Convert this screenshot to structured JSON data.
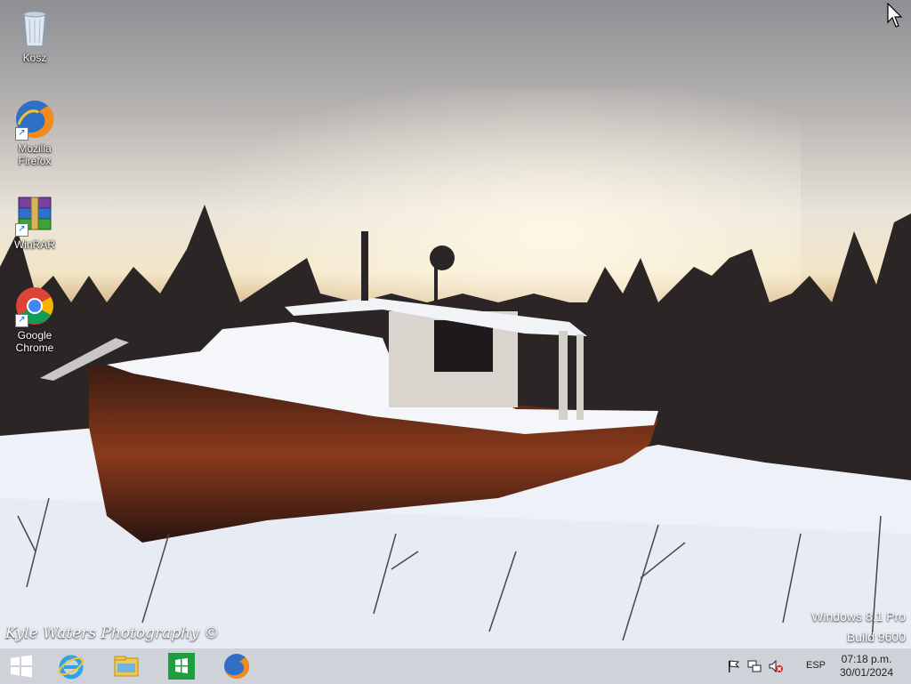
{
  "desktop": {
    "icons": [
      {
        "label": "Kosz",
        "icon": "recycle-bin-icon"
      },
      {
        "label": "Mozilla Firefox",
        "icon": "firefox-icon"
      },
      {
        "label": "WinRAR",
        "icon": "winrar-icon"
      },
      {
        "label": "Google Chrome",
        "icon": "chrome-icon"
      }
    ],
    "watermark": {
      "line1": "Windows 8.1 Pro",
      "line2": "Build 9600"
    },
    "wallpaper_credit": "Kyle Waters Photography ©"
  },
  "taskbar": {
    "pinned": [
      {
        "icon": "start-icon"
      },
      {
        "icon": "internet-explorer-icon"
      },
      {
        "icon": "file-explorer-icon"
      },
      {
        "icon": "windows-store-icon"
      },
      {
        "icon": "firefox-icon"
      }
    ],
    "tray": {
      "icons": [
        "action-center-flag-icon",
        "network-icon",
        "volume-muted-icon"
      ],
      "language": "ESP",
      "time": "07:18 p.m.",
      "date": "30/01/2024"
    }
  }
}
